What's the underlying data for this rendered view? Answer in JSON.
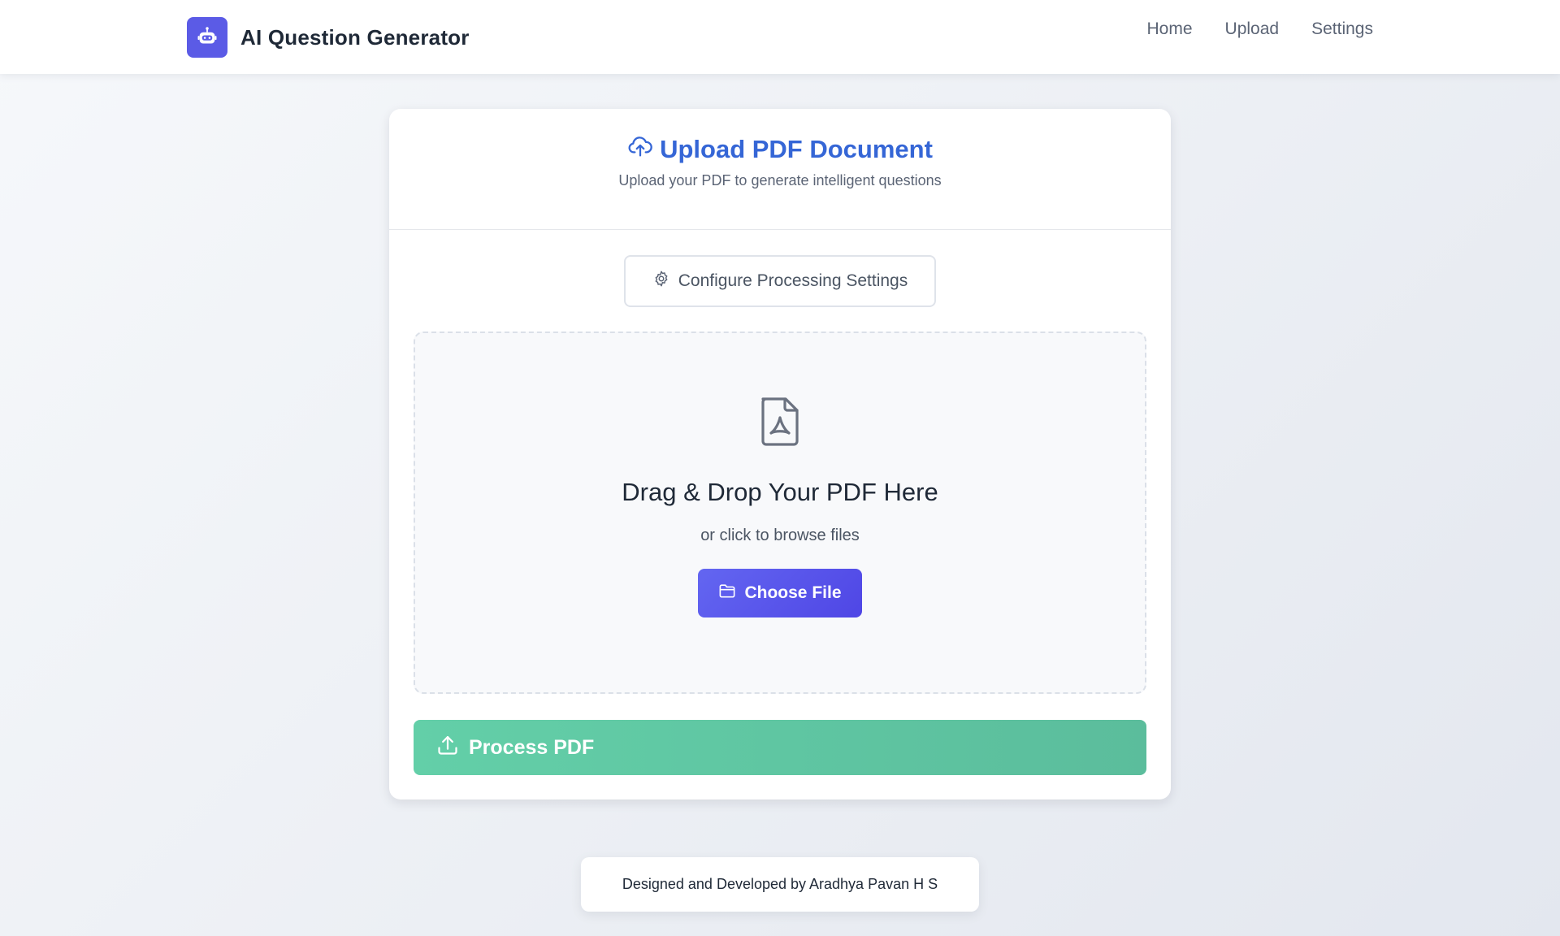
{
  "navbar": {
    "brand_title": "AI Question Generator",
    "brand_icon": "robot-icon",
    "links": [
      "Home",
      "Upload",
      "Settings"
    ]
  },
  "upload_card": {
    "title": "Upload PDF Document",
    "title_icon": "cloud-upload-icon",
    "subtitle": "Upload your PDF to generate intelligent questions",
    "config_button_label": "Configure Processing Settings",
    "config_button_icon": "gear-icon",
    "dropzone": {
      "icon": "file-pdf-icon",
      "title": "Drag & Drop Your PDF Here",
      "subtitle": "or click to browse files",
      "choose_button_label": "Choose File",
      "choose_button_icon": "folder-icon"
    },
    "process_button_label": "Process PDF",
    "process_button_icon": "upload-icon"
  },
  "footer": {
    "text": "Designed and Developed by Aradhya Pavan H S"
  },
  "colors": {
    "brand": "#5b5be6",
    "title_blue": "#3566d6",
    "primary_button": "#5b5bf0",
    "process_button": "#60c7a3"
  }
}
